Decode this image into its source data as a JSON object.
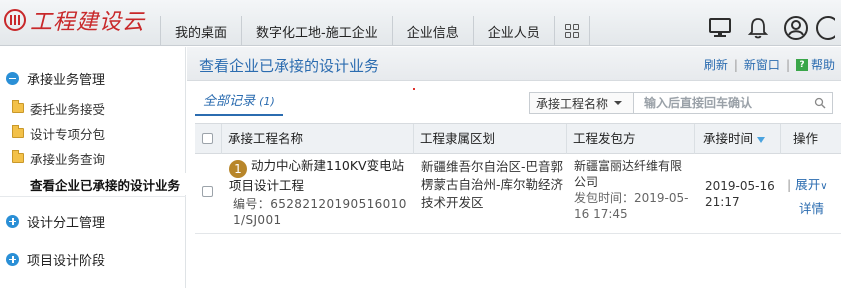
{
  "app": {
    "logo_text": "工程建设云"
  },
  "nav": {
    "tabs": [
      {
        "label": "我的桌面"
      },
      {
        "label": "数字化工地-施工企业"
      },
      {
        "label": "企业信息"
      },
      {
        "label": "企业人员"
      }
    ]
  },
  "sidebar": {
    "sections": [
      {
        "label": "承接业务管理"
      },
      {
        "label": "设计分工管理"
      },
      {
        "label": "项目设计阶段"
      }
    ],
    "items": [
      {
        "label": "委托业务接受"
      },
      {
        "label": "设计专项分包"
      },
      {
        "label": "承接业务查询"
      },
      {
        "label": "查看企业已承接的设计业务"
      }
    ]
  },
  "main": {
    "title": "查看企业已承接的设计业务",
    "links": {
      "refresh": "刷新",
      "new_window": "新窗口",
      "help": "帮助"
    },
    "tab": {
      "label": "全部记录",
      "count": "(1)"
    },
    "filter": {
      "field": "承接工程名称",
      "placeholder": "输入后直接回车确认"
    },
    "table": {
      "headers": [
        "承接工程名称",
        "工程隶属区划",
        "工程发包方",
        "承接时间",
        "操作"
      ],
      "rows": [
        {
          "index": "1",
          "name": "动力中心新建110KV变电站项目设计工程",
          "code": "编号：65282120190516010 1/SJ001",
          "district": "新疆维吾尔自治区-巴音郭楞蒙古自治州-库尔勒经济技术开发区",
          "issuer": "新疆富丽达纤维有限公司",
          "issue_time": "发包时间：2019-05-16 17:45",
          "accept_time": "2019-05-16 21:17",
          "expand": "展开",
          "detail": "详情"
        }
      ]
    }
  },
  "colors": {
    "brand": "#c8282a",
    "link": "#2b6cb0",
    "accent": "#2a8fd6"
  }
}
